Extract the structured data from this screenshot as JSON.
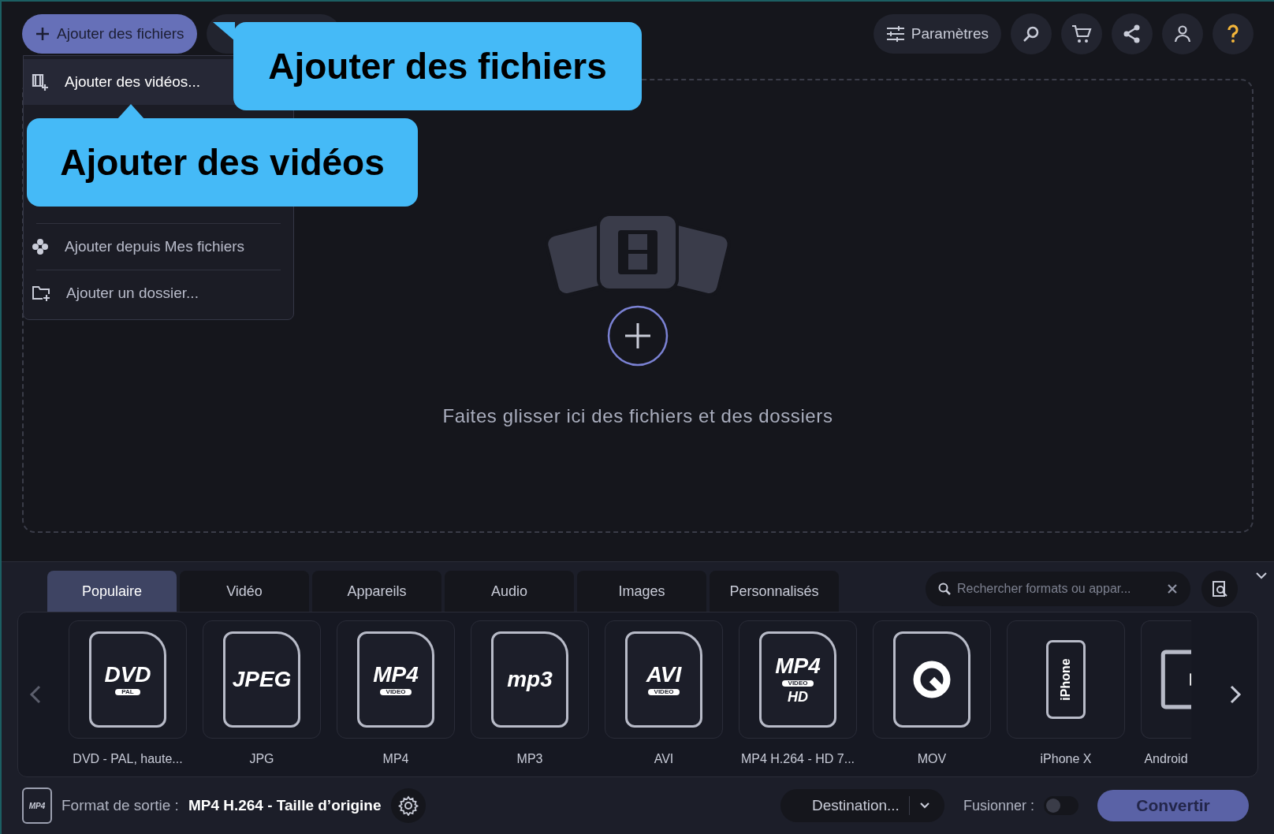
{
  "toolbar": {
    "add_button": "Ajouter des fichiers",
    "settings_button": "Paramètres"
  },
  "add_menu": {
    "items": [
      {
        "label": "Ajouter des vidéos...",
        "kind": "video",
        "selected": true
      },
      {
        "label": "Ajouter depuis Mes fichiers",
        "kind": "cloud",
        "selected": false
      },
      {
        "label": "Ajouter un dossier...",
        "kind": "folder",
        "selected": false
      }
    ]
  },
  "callouts": [
    {
      "text": "Ajouter des fichiers"
    },
    {
      "text": "Ajouter des vidéos"
    }
  ],
  "drop_zone": {
    "text": "Faites glisser ici des fichiers et des dossiers"
  },
  "tabs": [
    {
      "label": "Populaire",
      "selected": true
    },
    {
      "label": "Vidéo",
      "selected": false
    },
    {
      "label": "Appareils",
      "selected": false
    },
    {
      "label": "Audio",
      "selected": false
    },
    {
      "label": "Images",
      "selected": false
    },
    {
      "label": "Personnalisés",
      "selected": false
    }
  ],
  "search": {
    "placeholder": "Rechercher formats ou appar..."
  },
  "formats": [
    {
      "label": "DVD - PAL, haute...",
      "kind": "file",
      "logo": "DVD",
      "sub": "PAL"
    },
    {
      "label": "JPG",
      "kind": "file",
      "logo": "JPEG"
    },
    {
      "label": "MP4",
      "kind": "file",
      "logo": "MP4",
      "sub": "VIDEO"
    },
    {
      "label": "MP3",
      "kind": "file",
      "logo": "mp3"
    },
    {
      "label": "AVI",
      "kind": "file",
      "logo": "AVI",
      "sub": "VIDEO"
    },
    {
      "label": "MP4 H.264 - HD 7...",
      "kind": "file",
      "logo": "MP4",
      "sub": "VIDEO",
      "sub2": "HD"
    },
    {
      "label": "MOV",
      "kind": "quicktime"
    },
    {
      "label": "iPhone X",
      "kind": "phone",
      "logo": "iPhone"
    },
    {
      "label": "Android",
      "kind": "tablet"
    }
  ],
  "footer": {
    "format_icon": "MP4",
    "output_label": "Format de sortie :",
    "output_value": "MP4 H.264 - Taille d’origine",
    "destination": "Destination...",
    "merge_label": "Fusionner :",
    "merge_on": false,
    "convert_button": "Convertir"
  }
}
